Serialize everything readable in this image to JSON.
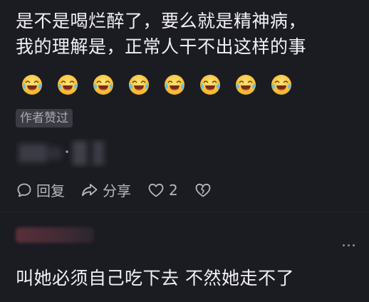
{
  "comment": {
    "line1": "是不是喝烂醉了，要么就是精神病，",
    "line2": "我的理解是，正常人干不出这样的事",
    "emoji_count": 8,
    "emoji_icon": "laughing-tears-emoji",
    "author_liked_badge": "作者赞过"
  },
  "actions": {
    "reply_label": "回复",
    "share_label": "分享",
    "like_count": "2",
    "reply_icon": "speech-bubble-icon",
    "share_icon": "share-arrow-icon",
    "like_icon": "heart-outline-icon",
    "dislike_icon": "broken-heart-icon"
  },
  "reply": {
    "text": "叫她必须自己吃下去 不然她走不了"
  },
  "colors": {
    "background": "#1b1b22",
    "text": "#f1f1f5",
    "muted": "#b8b8c0",
    "badge_bg": "#3b3b44"
  }
}
